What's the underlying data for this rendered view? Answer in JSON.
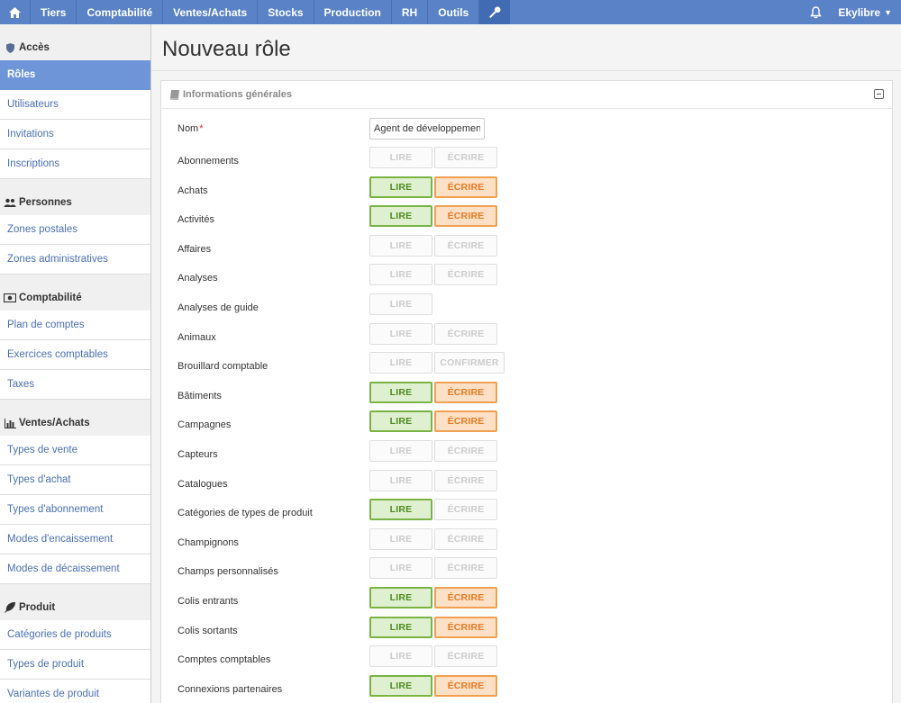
{
  "topbar": {
    "home_icon": "home-icon",
    "items": [
      "Tiers",
      "Comptabilité",
      "Ventes/Achats",
      "Stocks",
      "Production",
      "RH",
      "Outils"
    ],
    "tools_icon": "wrench-icon",
    "bell_icon": "bell-icon",
    "user": "Ekylibre",
    "accent": "#5a82c6"
  },
  "sidebar": {
    "sections": [
      {
        "title": "Accès",
        "icon": "shield-icon",
        "items": [
          "Rôles",
          "Utilisateurs",
          "Invitations",
          "Inscriptions"
        ]
      },
      {
        "title": "Personnes",
        "icon": "people-icon",
        "items": [
          "Zones postales",
          "Zones administratives"
        ]
      },
      {
        "title": "Comptabilité",
        "icon": "money-icon",
        "items": [
          "Plan de comptes",
          "Exercices comptables",
          "Taxes"
        ]
      },
      {
        "title": "Ventes/Achats",
        "icon": "bar-chart-icon",
        "items": [
          "Types de vente",
          "Types d'achat",
          "Types d'abonnement",
          "Modes d'encaissement",
          "Modes de décaissement"
        ]
      },
      {
        "title": "Produit",
        "icon": "leaf-icon",
        "items": [
          "Catégories de produits",
          "Types de produit",
          "Variantes de produit"
        ]
      }
    ],
    "active": "Rôles"
  },
  "page": {
    "title": "Nouveau rôle",
    "panel_title": "Informations générales",
    "name_label": "Nom",
    "name_required_mark": "*",
    "name_value": "Agent de développement"
  },
  "labels": {
    "read": "LIRE",
    "write": "ÉCRIRE",
    "confirm": "CONFIRMER"
  },
  "rights": [
    {
      "name": "Abonnements",
      "read": false,
      "write": false
    },
    {
      "name": "Achats",
      "read": true,
      "write": true
    },
    {
      "name": "Activités",
      "read": true,
      "write": true
    },
    {
      "name": "Affaires",
      "read": false,
      "write": false
    },
    {
      "name": "Analyses",
      "read": false,
      "write": false
    },
    {
      "name": "Analyses de guide",
      "read": false,
      "write": null
    },
    {
      "name": "Animaux",
      "read": false,
      "write": false
    },
    {
      "name": "Brouillard comptable",
      "read": false,
      "confirm": false
    },
    {
      "name": "Bâtiments",
      "read": true,
      "write": true
    },
    {
      "name": "Campagnes",
      "read": true,
      "write": true
    },
    {
      "name": "Capteurs",
      "read": false,
      "write": false
    },
    {
      "name": "Catalogues",
      "read": false,
      "write": false
    },
    {
      "name": "Catégories de types de produit",
      "read": true,
      "write": false
    },
    {
      "name": "Champignons",
      "read": false,
      "write": false
    },
    {
      "name": "Champs personnalisés",
      "read": false,
      "write": false
    },
    {
      "name": "Colis entrants",
      "read": true,
      "write": true
    },
    {
      "name": "Colis sortants",
      "read": true,
      "write": true
    },
    {
      "name": "Comptes comptables",
      "read": false,
      "write": false
    },
    {
      "name": "Connexions partenaires",
      "read": true,
      "write": true
    }
  ],
  "colors": {
    "read_on_bg": "#dff0d0",
    "read_on_border": "#7ab343",
    "write_on_bg": "#fde0c6",
    "write_on_border": "#f0a050"
  }
}
